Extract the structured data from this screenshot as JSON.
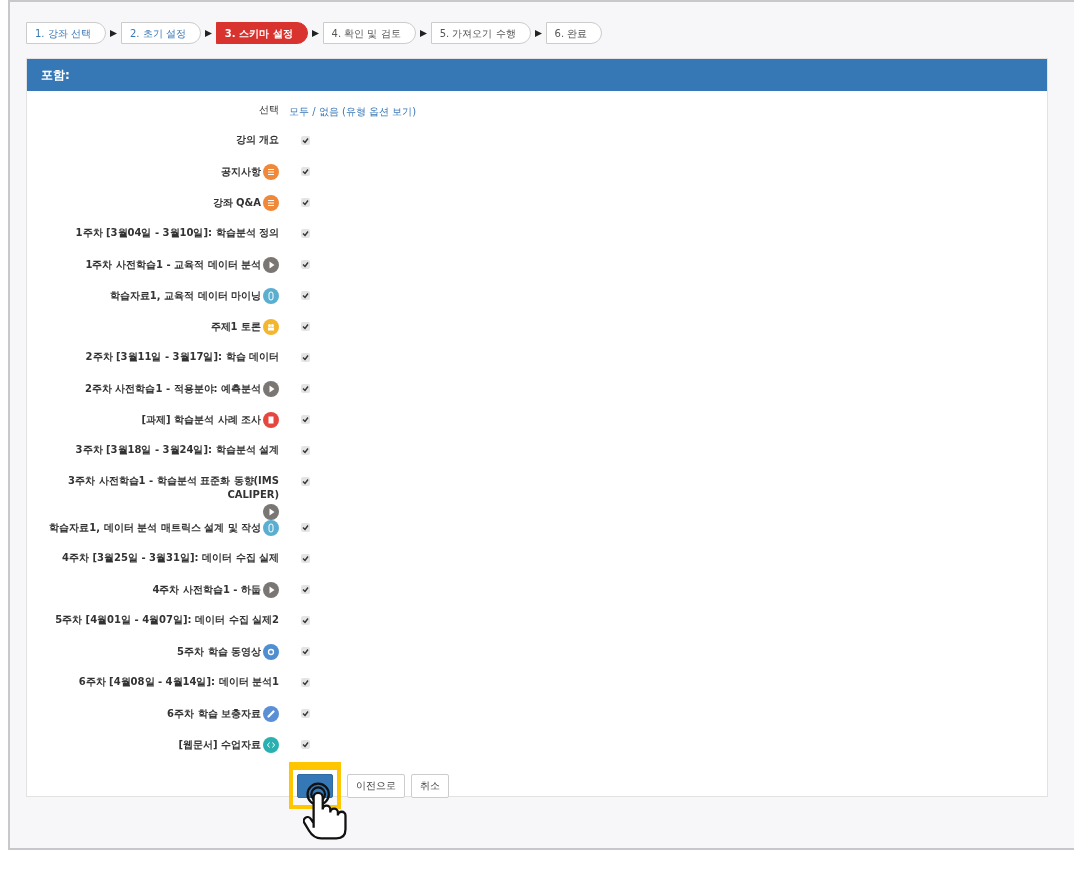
{
  "steps": [
    {
      "label": "1. 강좌 선택",
      "selected": false
    },
    {
      "label": "2. 초기 설정",
      "selected": false
    },
    {
      "label": "3. 스키마 설정",
      "selected": true
    },
    {
      "label": "4. 확인 및 검토",
      "selected": false
    },
    {
      "label": "5. 가져오기 수행",
      "selected": false
    },
    {
      "label": "6. 완료",
      "selected": false
    }
  ],
  "panel": {
    "title": "포함:",
    "select_label": "선택",
    "select_links": "모두 / 없음 (유형 옵션 보기)"
  },
  "items": [
    {
      "label": "강의 개요",
      "kind": "section",
      "checked": true
    },
    {
      "label": "공지사항",
      "kind": "notice",
      "checked": true
    },
    {
      "label": "강좌 Q&A",
      "kind": "notice",
      "checked": true
    },
    {
      "label": "1주차 [3월04일 - 3월10일]: 학습분석 정의",
      "kind": "section",
      "checked": true
    },
    {
      "label": "1주차 사전학습1 - 교육적 데이터 분석",
      "kind": "video",
      "checked": true
    },
    {
      "label": "학습자료1, 교육적 데이터 마이닝",
      "kind": "file",
      "checked": true
    },
    {
      "label": "주제1 토론",
      "kind": "forum",
      "checked": true
    },
    {
      "label": "2주차 [3월11일 - 3월17일]: 학습 데이터",
      "kind": "section",
      "checked": true
    },
    {
      "label": "2주차 사전학습1 - 적용분야: 예측분석",
      "kind": "video",
      "checked": true
    },
    {
      "label": "[과제] 학습분석 사례 조사",
      "kind": "assignment",
      "checked": true
    },
    {
      "label": "3주차 [3월18일 - 3월24일]: 학습분석 설계",
      "kind": "section",
      "checked": true
    },
    {
      "label": "3주차 사전학습1 - 학습분석 표준화 동향(IMS CALIPER)",
      "kind": "video",
      "checked": true
    },
    {
      "label": "학습자료1, 데이터 분석 매트릭스 설계 및 작성",
      "kind": "file",
      "checked": true
    },
    {
      "label": "4주차 [3월25일 - 3월31일]: 데이터 수집 실제",
      "kind": "section",
      "checked": true
    },
    {
      "label": "4주차 사전학습1 - 하둡",
      "kind": "video",
      "checked": true
    },
    {
      "label": "5주차 [4월01일 - 4월07일]: 데이터 수집 실제2",
      "kind": "section",
      "checked": true
    },
    {
      "label": "5주차 학습 동영상",
      "kind": "media",
      "checked": true
    },
    {
      "label": "6주차 [4월08일 - 4월14일]: 데이터 분석1",
      "kind": "section",
      "checked": true
    },
    {
      "label": "6주차 학습 보충자료",
      "kind": "link",
      "checked": true
    },
    {
      "label": "[웹문서] 수업자료",
      "kind": "webpage",
      "checked": true
    }
  ],
  "buttons": [
    {
      "kind": "primary"
    },
    {
      "kind": "default",
      "label": "이전으로"
    },
    {
      "kind": "default",
      "label": "취소"
    }
  ],
  "pointer": {
    "highlighted": true
  }
}
